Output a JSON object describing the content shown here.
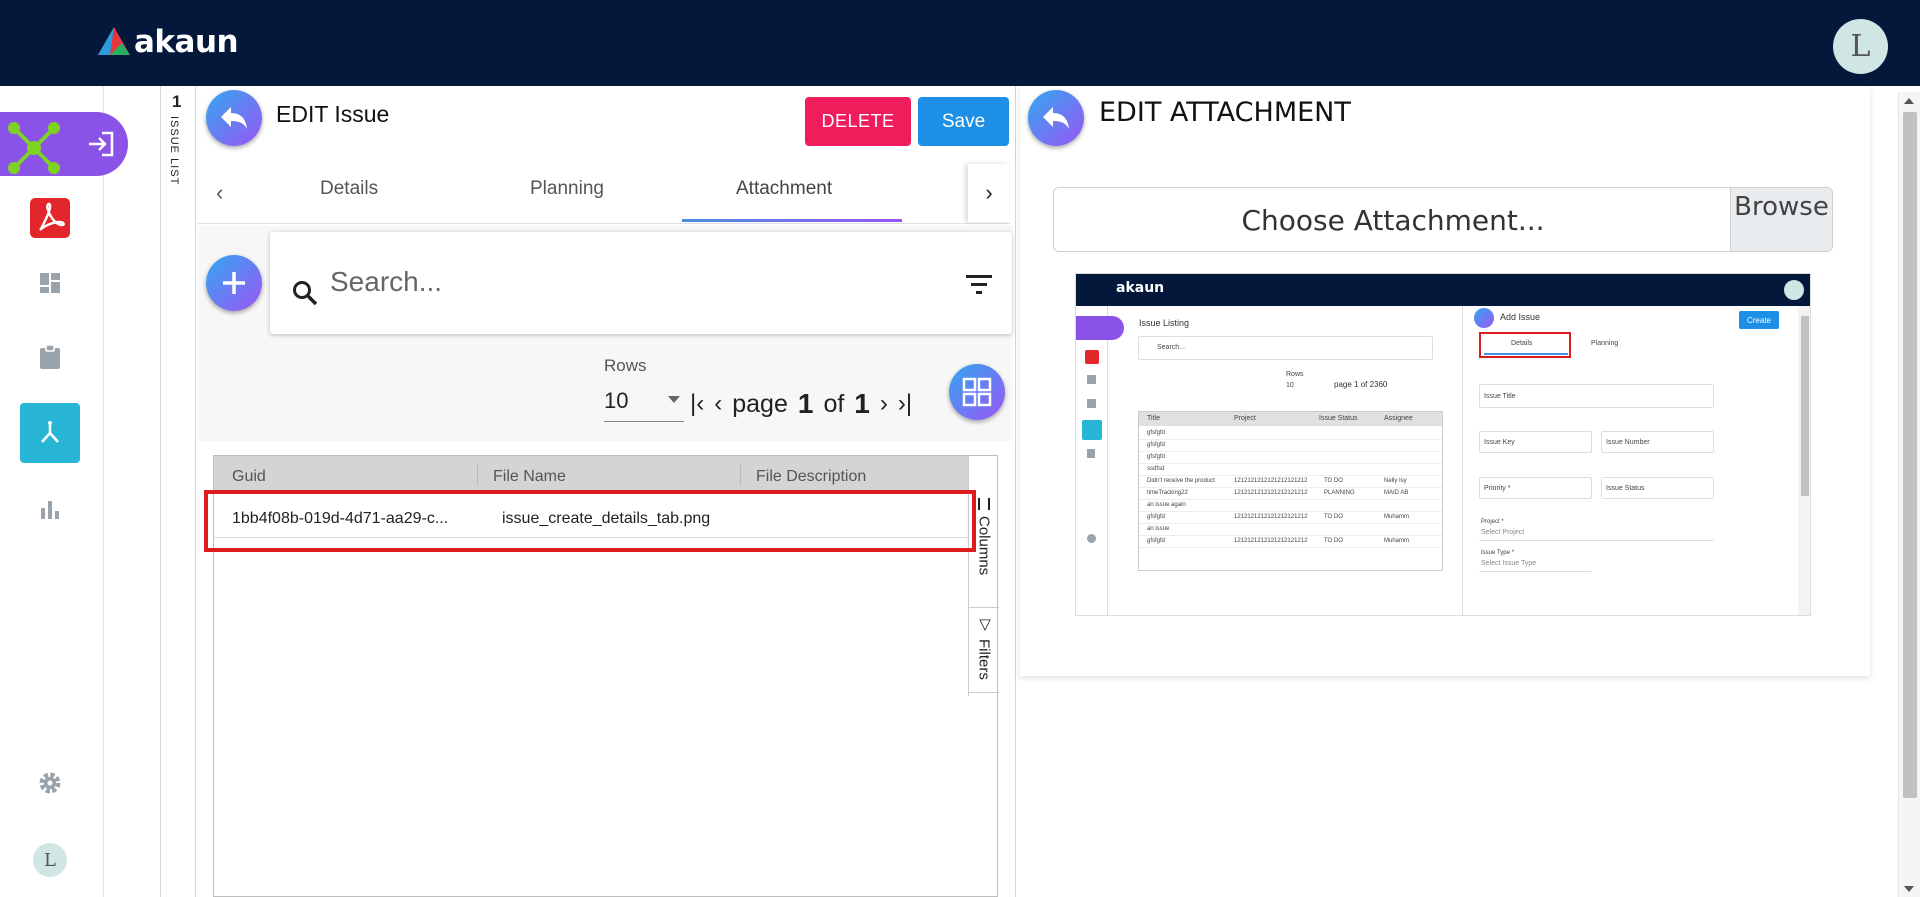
{
  "app": {
    "brand": "akaun",
    "user_avatar_letter": "L"
  },
  "sidebar": {
    "items": [
      {
        "icon": "apps-network-icon",
        "active": false
      },
      {
        "icon": "acrobat-icon",
        "active": false
      },
      {
        "icon": "dashboard-icon",
        "active": false
      },
      {
        "icon": "clipboard-icon",
        "active": false
      },
      {
        "icon": "fork-icon",
        "active": true
      },
      {
        "icon": "bar-chart-icon",
        "active": false
      },
      {
        "icon": "gear-icon",
        "active": false
      }
    ],
    "user_avatar_letter": "L"
  },
  "issue_list": {
    "count": "1",
    "label": "ISSUE LIST"
  },
  "edit_issue": {
    "title": "EDIT Issue",
    "delete_label": "DELETE",
    "save_label": "Save",
    "tabs": [
      "Details",
      "Planning",
      "Attachment"
    ],
    "active_tab": "Attachment",
    "search_placeholder": "Search...",
    "rows_label": "Rows",
    "rows_value": "10",
    "pager": {
      "page_label": "page",
      "current": "1",
      "of_label": "of",
      "total": "1"
    },
    "grid": {
      "columns": [
        "Guid",
        "File Name",
        "File Description"
      ],
      "rows": [
        {
          "guid": "1bb4f08b-019d-4d71-aa29-c...",
          "file_name": "issue_create_details_tab.png",
          "file_description": ""
        }
      ],
      "side_tabs": [
        "Columns",
        "Filters"
      ]
    }
  },
  "edit_attachment": {
    "title": "EDIT ATTACHMENT",
    "file_label": "Choose Attachment...",
    "browse_label": "Browse"
  },
  "preview": {
    "brand": "akaun",
    "left_title": "Issue Listing",
    "search_placeholder": "Search...",
    "rows_label": "Rows",
    "rows_value": "10",
    "pager": "page 1 of 2360",
    "columns": [
      "Title",
      "Project",
      "Issue Status",
      "Assignee"
    ],
    "rows": [
      {
        "title": "gfsfgfd",
        "project": "",
        "status": "",
        "assignee": ""
      },
      {
        "title": "gfsfgfd",
        "project": "",
        "status": "",
        "assignee": ""
      },
      {
        "title": "gfsfgfd",
        "project": "",
        "status": "",
        "assignee": ""
      },
      {
        "title": "ssdfsd",
        "project": "",
        "status": "",
        "assignee": ""
      },
      {
        "title": "Didn't receive the product",
        "project": "1212121212121212121212",
        "status": "TO DO",
        "assignee": "Nelly Isy"
      },
      {
        "title": "timeTracking22",
        "project": "1212121212121212121212",
        "status": "PLANNING",
        "assignee": "MAID AB"
      },
      {
        "title": "an issue again",
        "project": "",
        "status": "",
        "assignee": ""
      },
      {
        "title": "gfsfgfd",
        "project": "1212121212121212121212",
        "status": "TO DO",
        "assignee": "Muhamm"
      },
      {
        "title": "an issue",
        "project": "",
        "status": "",
        "assignee": ""
      },
      {
        "title": "gfsfgfd",
        "project": "1212121212121212121212",
        "status": "TO DO",
        "assignee": "Muhamm"
      }
    ],
    "right_title": "Add Issue",
    "create_label": "Create",
    "tabs": [
      "Details",
      "Planning"
    ],
    "fields": {
      "issue_title": "Issue Title",
      "issue_key": "Issue Key",
      "issue_number": "Issue Number",
      "priority": "Priority *",
      "issue_status": "Issue Status",
      "project_label": "Project *",
      "project_placeholder": "Select Project",
      "issue_type_label": "Issue Type *",
      "issue_type_placeholder": "Select Issue Type"
    }
  },
  "colors": {
    "topbar": "#03183a",
    "accent_purple": "#8a52e6",
    "accent_cyan": "#29b6d6",
    "delete": "#ef1d5c",
    "save": "#1d8fe5",
    "highlight": "#dd1d1d"
  }
}
